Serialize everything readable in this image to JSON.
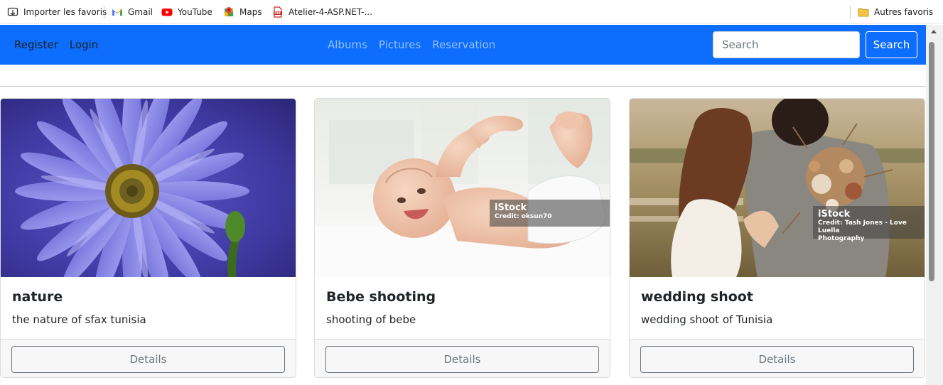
{
  "bookmarks": {
    "items": [
      {
        "label": "Importer les favoris",
        "icon": "import-bookmarks-icon"
      },
      {
        "label": "Gmail",
        "icon": "gmail-icon"
      },
      {
        "label": "YouTube",
        "icon": "youtube-icon"
      },
      {
        "label": "Maps",
        "icon": "maps-icon"
      },
      {
        "label": "Atelier-4-ASP.NET-...",
        "icon": "pdf-icon"
      }
    ],
    "other": {
      "label": "Autres favoris",
      "icon": "folder-icon"
    }
  },
  "navbar": {
    "left_links": [
      "Register",
      "Login"
    ],
    "center_links": [
      "Albums",
      "Pictures",
      "Reservation"
    ],
    "search": {
      "placeholder": "Search",
      "value": "",
      "button": "Search"
    },
    "colors": {
      "background": "#0d6efd",
      "link_muted": "rgba(255,255,255,0.55)"
    }
  },
  "cards": [
    {
      "title": "nature",
      "text": "the nature of sfax tunisia",
      "button": "Details",
      "image": "purple-aster-flower"
    },
    {
      "title": "Bebe shooting",
      "text": "shooting of bebe",
      "button": "Details",
      "image": "laughing-baby",
      "watermark": {
        "brand": "iStock",
        "credit": "Credit: oksun70"
      }
    },
    {
      "title": "wedding shoot",
      "text": "wedding shoot of Tunisia",
      "button": "Details",
      "image": "couple-with-bouquet",
      "watermark": {
        "brand": "iStock",
        "credit": "Credit: Tash Jones - Love Luella",
        "credit2": "Photography"
      }
    }
  ]
}
